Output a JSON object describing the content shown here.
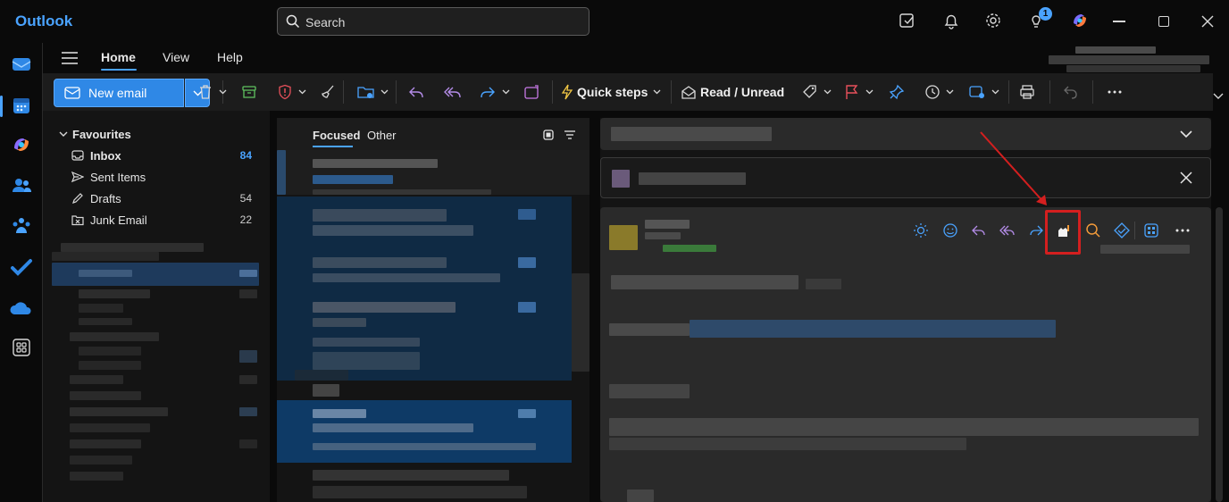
{
  "app": {
    "title": "Outlook"
  },
  "search": {
    "placeholder": "Search"
  },
  "titlebar": {
    "notification_count": "1"
  },
  "ribbon": {
    "tabs": [
      "Home",
      "View",
      "Help"
    ],
    "new_email": "New email",
    "quick_steps": "Quick steps",
    "read_unread": "Read / Unread"
  },
  "folders": {
    "header": "Favourites",
    "items": [
      {
        "label": "Inbox",
        "count": "84"
      },
      {
        "label": "Sent Items",
        "count": ""
      },
      {
        "label": "Drafts",
        "count": "54"
      },
      {
        "label": "Junk Email",
        "count": "22"
      }
    ]
  },
  "message_list": {
    "tabs": [
      "Focused",
      "Other"
    ]
  },
  "colors": {
    "accent": "#4aa3ff",
    "button_blue": "#2f88e6",
    "highlight_red": "#d41f1f",
    "background": "#0a0a0a"
  }
}
